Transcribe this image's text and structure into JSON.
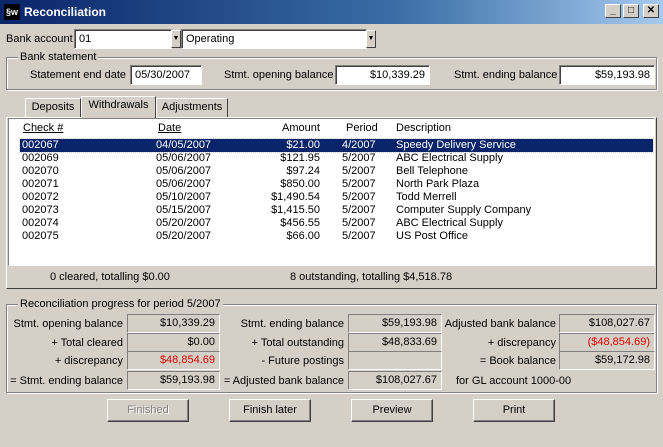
{
  "window": {
    "title": "Reconciliation",
    "icon_text": "§w",
    "minimize": "_",
    "maximize": "□",
    "close": "✕"
  },
  "bank": {
    "label": "Bank account",
    "account_number": "01",
    "account_name": "Operating"
  },
  "statement": {
    "group_title": "Bank statement",
    "end_date_label": "Statement end date",
    "end_date": "05/30/2007",
    "opening_label": "Stmt. opening balance",
    "opening": "$10,339.29",
    "ending_label": "Stmt. ending balance",
    "ending": "$59,193.98"
  },
  "tabs": [
    "Deposits",
    "Withdrawals",
    "Adjustments"
  ],
  "columns": {
    "check": "Check #",
    "date": "Date",
    "amount": "Amount",
    "period": "Period",
    "description": "Description"
  },
  "rows": [
    {
      "check": "002067",
      "date": "04/05/2007",
      "amount": "$21.00",
      "period": "4/2007",
      "desc": "Speedy Delivery Service"
    },
    {
      "check": "002069",
      "date": "05/06/2007",
      "amount": "$121.95",
      "period": "5/2007",
      "desc": "ABC Electrical Supply"
    },
    {
      "check": "002070",
      "date": "05/06/2007",
      "amount": "$97.24",
      "period": "5/2007",
      "desc": "Bell Telephone"
    },
    {
      "check": "002071",
      "date": "05/06/2007",
      "amount": "$850.00",
      "period": "5/2007",
      "desc": "North Park Plaza"
    },
    {
      "check": "002072",
      "date": "05/10/2007",
      "amount": "$1,490.54",
      "period": "5/2007",
      "desc": "Todd Merrell"
    },
    {
      "check": "002073",
      "date": "05/15/2007",
      "amount": "$1,415.50",
      "period": "5/2007",
      "desc": "Computer Supply Company"
    },
    {
      "check": "002074",
      "date": "05/20/2007",
      "amount": "$456.55",
      "period": "5/2007",
      "desc": "ABC Electrical Supply"
    },
    {
      "check": "002075",
      "date": "05/20/2007",
      "amount": "$66.00",
      "period": "5/2007",
      "desc": "US Post Office"
    }
  ],
  "summary": {
    "cleared": "0  cleared, totalling $0.00",
    "outstanding": "8 outstanding, totalling $4,518.78"
  },
  "progress": {
    "group_title": "Reconciliation progress for period  5/2007",
    "col1": {
      "opening_label": "Stmt. opening balance",
      "opening": "$10,339.29",
      "cleared_label": "+ Total cleared",
      "cleared": "$0.00",
      "disc_label": "+ discrepancy",
      "disc": "$48,854.69",
      "ending_label": "= Stmt. ending balance",
      "ending": "$59,193.98"
    },
    "col2": {
      "ending_label": "Stmt. ending balance",
      "ending": "$59,193.98",
      "outstanding_label": "+ Total outstanding",
      "outstanding": "$48,833.69",
      "future_label": "- Future postings",
      "future": "",
      "adjusted_label": "= Adjusted bank balance",
      "adjusted": "$108,027.67"
    },
    "col3": {
      "adjusted_label": "Adjusted bank balance",
      "adjusted": "$108,027.67",
      "disc_label": "+ discrepancy",
      "disc": "($48,854.69)",
      "book_label": "= Book balance",
      "book": "$59,172.98",
      "gl_note": "for GL account 1000-00"
    }
  },
  "buttons": {
    "finished": "Finished",
    "finish_later": "Finish later",
    "preview": "Preview",
    "print": "Print"
  },
  "colors": {
    "title_bar": "#0a246a",
    "window_bg": "#d4d0c8",
    "selection": "#0a246a",
    "discrepancy": "#e00000"
  }
}
